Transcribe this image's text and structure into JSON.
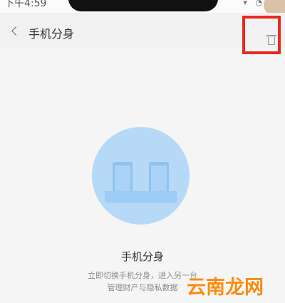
{
  "status_bar": {
    "time": "下午4:59",
    "icons": "▾ ◔"
  },
  "header": {
    "title": "手机分身"
  },
  "main": {
    "title": "手机分身",
    "description_line1": "立即切换手机分身，进入另一台",
    "description_line2": "管理财产与隐私数据"
  },
  "watermark": "云南龙网",
  "colors": {
    "highlight": "#e8291f",
    "illustration": "#b6d9f8",
    "watermark": "#fb8a10"
  }
}
